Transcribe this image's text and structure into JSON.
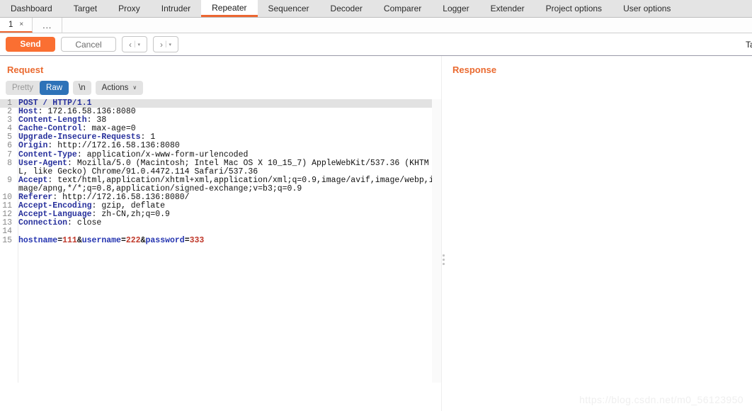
{
  "main_tabs": [
    {
      "label": "Dashboard",
      "active": false
    },
    {
      "label": "Target",
      "active": false
    },
    {
      "label": "Proxy",
      "active": false
    },
    {
      "label": "Intruder",
      "active": false
    },
    {
      "label": "Repeater",
      "active": true
    },
    {
      "label": "Sequencer",
      "active": false
    },
    {
      "label": "Decoder",
      "active": false
    },
    {
      "label": "Comparer",
      "active": false
    },
    {
      "label": "Logger",
      "active": false
    },
    {
      "label": "Extender",
      "active": false
    },
    {
      "label": "Project options",
      "active": false
    },
    {
      "label": "User options",
      "active": false
    }
  ],
  "request_tabs": {
    "items": [
      {
        "label": "1",
        "close": "×",
        "active": true
      }
    ],
    "more_label": "..."
  },
  "toolbar": {
    "send_label": "Send",
    "cancel_label": "Cancel",
    "back_chevron": "‹",
    "forward_chevron": "›",
    "separator": "|",
    "caret": "▾",
    "target_label": "Ta"
  },
  "request_pane": {
    "title": "Request",
    "viewbar": {
      "pretty_label": "Pretty",
      "raw_label": "Raw",
      "newline_label": "\\n",
      "actions_label": "Actions",
      "actions_caret": "∨"
    },
    "lines": [
      {
        "n": "1",
        "highlight": true,
        "segs": [
          {
            "t": "POST / HTTP/1.1",
            "c": "hdr"
          }
        ]
      },
      {
        "n": "2",
        "segs": [
          {
            "t": "Host",
            "c": "hdr"
          },
          {
            "t": ": 172.16.58.136:8080",
            "c": "val"
          }
        ]
      },
      {
        "n": "3",
        "segs": [
          {
            "t": "Content-Length",
            "c": "hdr"
          },
          {
            "t": ": 38",
            "c": "val"
          }
        ]
      },
      {
        "n": "4",
        "segs": [
          {
            "t": "Cache-Control",
            "c": "hdr"
          },
          {
            "t": ": max-age=0",
            "c": "val"
          }
        ]
      },
      {
        "n": "5",
        "segs": [
          {
            "t": "Upgrade-Insecure-Requests",
            "c": "hdr"
          },
          {
            "t": ": 1",
            "c": "val"
          }
        ]
      },
      {
        "n": "6",
        "segs": [
          {
            "t": "Origin",
            "c": "hdr"
          },
          {
            "t": ": http://172.16.58.136:8080",
            "c": "val"
          }
        ]
      },
      {
        "n": "7",
        "segs": [
          {
            "t": "Content-Type",
            "c": "hdr"
          },
          {
            "t": ": application/x-www-form-urlencoded",
            "c": "val"
          }
        ]
      },
      {
        "n": "8",
        "segs": [
          {
            "t": "User-Agent",
            "c": "hdr"
          },
          {
            "t": ": Mozilla/5.0 (Macintosh; Intel Mac OS X 10_15_7) AppleWebKit/537.36 (KHTML, like Gecko) Chrome/91.0.4472.114 Safari/537.36",
            "c": "val"
          }
        ]
      },
      {
        "n": "9",
        "segs": [
          {
            "t": "Accept",
            "c": "hdr"
          },
          {
            "t": ": text/html,application/xhtml+xml,application/xml;q=0.9,image/avif,image/webp,image/apng,*/*;q=0.8,application/signed-exchange;v=b3;q=0.9",
            "c": "val"
          }
        ]
      },
      {
        "n": "10",
        "segs": [
          {
            "t": "Referer",
            "c": "hdr"
          },
          {
            "t": ": http://172.16.58.136:8080/",
            "c": "val"
          }
        ]
      },
      {
        "n": "11",
        "segs": [
          {
            "t": "Accept-Encoding",
            "c": "hdr"
          },
          {
            "t": ": gzip, deflate",
            "c": "val"
          }
        ]
      },
      {
        "n": "12",
        "segs": [
          {
            "t": "Accept-Language",
            "c": "hdr"
          },
          {
            "t": ": zh-CN,zh;q=0.9",
            "c": "val"
          }
        ]
      },
      {
        "n": "13",
        "segs": [
          {
            "t": "Connection",
            "c": "hdr"
          },
          {
            "t": ": close",
            "c": "val"
          }
        ]
      },
      {
        "n": "14",
        "segs": [
          {
            "t": "",
            "c": "val"
          }
        ]
      },
      {
        "n": "15",
        "segs": [
          {
            "t": "hostname",
            "c": "pname"
          },
          {
            "t": "=",
            "c": "psep"
          },
          {
            "t": "111",
            "c": "pval"
          },
          {
            "t": "&",
            "c": "psep"
          },
          {
            "t": "username",
            "c": "pname"
          },
          {
            "t": "=",
            "c": "psep"
          },
          {
            "t": "222",
            "c": "pval"
          },
          {
            "t": "&",
            "c": "psep"
          },
          {
            "t": "password",
            "c": "pname"
          },
          {
            "t": "=",
            "c": "psep"
          },
          {
            "t": "333",
            "c": "pval"
          }
        ]
      }
    ]
  },
  "response_pane": {
    "title": "Response",
    "body": ""
  },
  "watermark": "https://blog.csdn.net/m0_56123950",
  "colors": {
    "accent_orange": "#ec6732",
    "send_orange": "#fa6f32",
    "selected_blue": "#2d72b8",
    "header_navy": "#27309c",
    "param_red": "#c0392b"
  }
}
